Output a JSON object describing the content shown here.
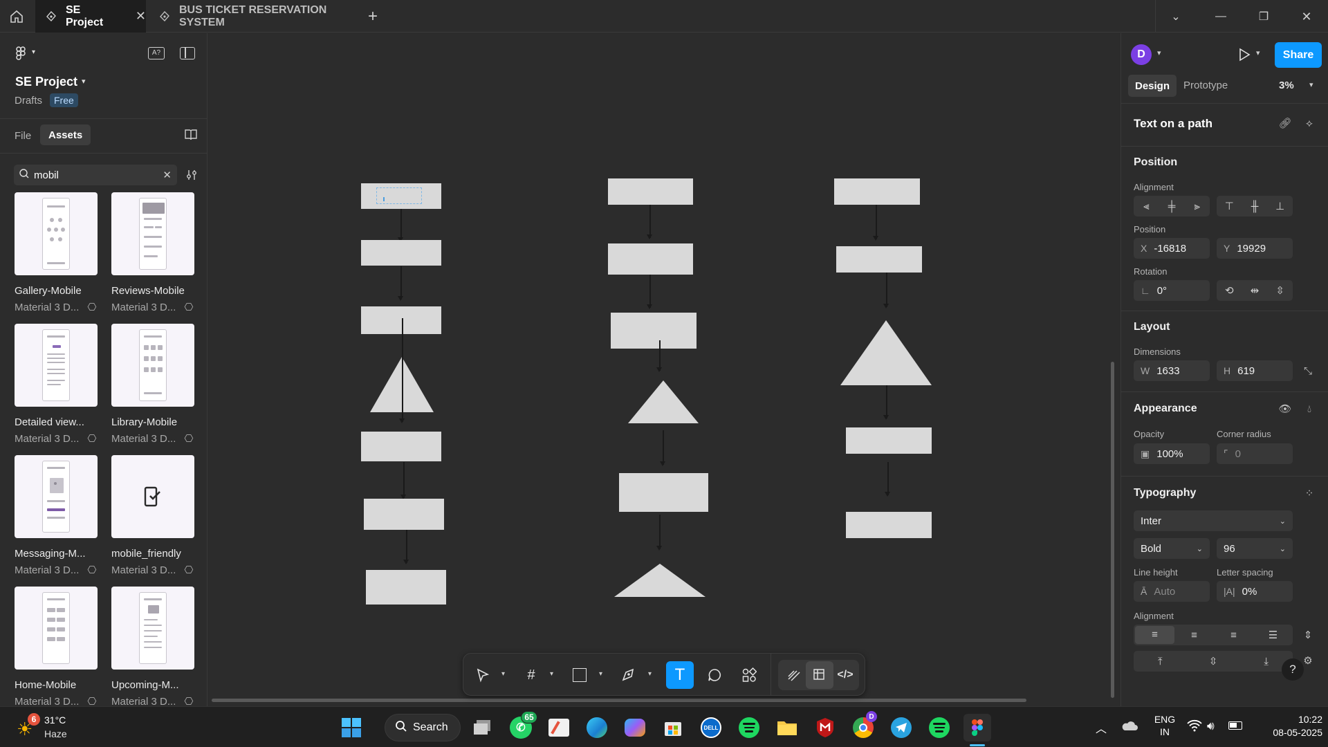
{
  "titlebar": {
    "tabs": [
      {
        "label": "SE Project",
        "active": true
      },
      {
        "label": "BUS TICKET RESERVATION SYSTEM",
        "active": false
      }
    ]
  },
  "left_panel": {
    "project_name": "SE Project",
    "drafts_label": "Drafts",
    "plan_badge": "Free",
    "tabs": [
      "File",
      "Assets"
    ],
    "active_tab": "Assets",
    "search": {
      "value": "mobil"
    },
    "assets": [
      {
        "name": "Gallery-Mobile",
        "library": "Material 3 D..."
      },
      {
        "name": "Reviews-Mobile",
        "library": "Material 3 D..."
      },
      {
        "name": "Detailed view...",
        "library": "Material 3 D..."
      },
      {
        "name": "Library-Mobile",
        "library": "Material 3 D..."
      },
      {
        "name": "Messaging-M...",
        "library": "Material 3 D..."
      },
      {
        "name": "mobile_friendly",
        "library": "Material 3 D..."
      },
      {
        "name": "Home-Mobile",
        "library": "Material 3 D..."
      },
      {
        "name": "Upcoming-M...",
        "library": "Material 3 D..."
      }
    ]
  },
  "right_panel": {
    "avatar_letter": "D",
    "share_label": "Share",
    "mode_tabs": [
      "Design",
      "Prototype"
    ],
    "active_mode": "Design",
    "zoom": "3%",
    "selection_title": "Text on a path",
    "position": {
      "section": "Position",
      "alignment_label": "Alignment",
      "position_label": "Position",
      "x_prefix": "X",
      "x": "-16818",
      "y_prefix": "Y",
      "y": "19929",
      "rotation_label": "Rotation",
      "rotation": "0°"
    },
    "layout": {
      "section": "Layout",
      "dimensions_label": "Dimensions",
      "w_prefix": "W",
      "w": "1633",
      "h_prefix": "H",
      "h": "619"
    },
    "appearance": {
      "section": "Appearance",
      "opacity_label": "Opacity",
      "opacity": "100%",
      "corner_label": "Corner radius",
      "corner": "0"
    },
    "typography": {
      "section": "Typography",
      "font": "Inter",
      "weight": "Bold",
      "size": "96",
      "line_height_label": "Line height",
      "line_height": "Auto",
      "letter_spacing_label": "Letter spacing",
      "letter_spacing": "0%",
      "alignment_label": "Alignment"
    }
  },
  "taskbar": {
    "weather_temp": "31°C",
    "weather_desc": "Haze",
    "weather_badge": "6",
    "search_label": "Search",
    "whatsapp_badge": "65",
    "chrome_badge": "D",
    "lang_top": "ENG",
    "lang_bottom": "IN",
    "time": "10:22",
    "date": "08-05-2025"
  },
  "colors": {
    "accent": "#0d99ff",
    "canvas_bg": "#2c2c2c",
    "shape_fill": "#d9d9d9",
    "avatar_bg": "#7b3fe4",
    "badge_red": "#e5533d"
  }
}
